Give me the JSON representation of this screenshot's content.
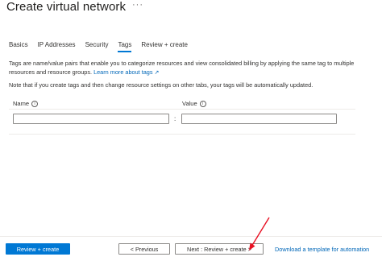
{
  "page": {
    "title": "Create virtual network",
    "more_label": "···"
  },
  "tabs": [
    {
      "label": "Basics"
    },
    {
      "label": "IP Addresses"
    },
    {
      "label": "Security"
    },
    {
      "label": "Tags",
      "active": true
    },
    {
      "label": "Review + create"
    }
  ],
  "description": {
    "text": "Tags are name/value pairs that enable you to categorize resources and view consolidated billing by applying the same tag to multiple resources and resource groups. ",
    "link": "Learn more about tags",
    "link_icon": "external-link-icon"
  },
  "note": "Note that if you create tags and then change resource settings on other tabs, your tags will be automatically updated.",
  "table": {
    "name_header": "Name",
    "value_header": "Value",
    "info_icon": "info-icon",
    "separator": ":",
    "name_value": "",
    "value_value": ""
  },
  "footer": {
    "review_create_label": "Review + create",
    "previous_label": "< Previous",
    "next_label": "Next : Review + create >",
    "download_link": "Download a template for automation"
  },
  "annotation": {
    "color": "#e81123",
    "icon": "red-arrow"
  }
}
